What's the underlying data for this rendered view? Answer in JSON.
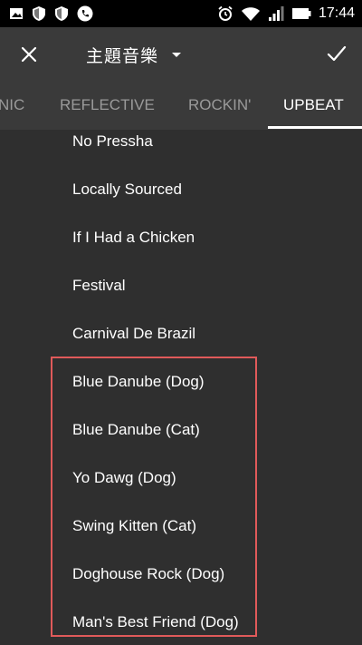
{
  "status_bar": {
    "time": "17:44",
    "left_icons": [
      "image-icon",
      "shield-icon",
      "shield-icon",
      "phone-icon"
    ],
    "right_icons": [
      "alarm-icon",
      "wifi-icon",
      "signal-icon",
      "battery-icon"
    ]
  },
  "toolbar": {
    "title": "主題音樂"
  },
  "tabs": [
    {
      "label": "NIC",
      "active": false
    },
    {
      "label": "REFLECTIVE",
      "active": false
    },
    {
      "label": "ROCKIN'",
      "active": false
    },
    {
      "label": "UPBEAT",
      "active": true
    }
  ],
  "tracks": [
    "No Pressha",
    "Locally Sourced",
    "If I Had a Chicken",
    "Festival",
    "Carnival De Brazil",
    "Blue Danube (Dog)",
    "Blue Danube (Cat)",
    "Yo Dawg (Dog)",
    "Swing Kitten (Cat)",
    "Doghouse Rock (Dog)",
    "Man's Best Friend (Dog)"
  ],
  "colors": {
    "highlight_border": "#e05a5a",
    "background": "#2f2f2f",
    "toolbar": "#3a3a3a"
  }
}
